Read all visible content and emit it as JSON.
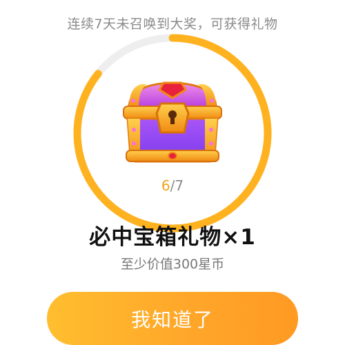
{
  "dialog": {
    "subtitle": "连续7天未召唤到大奖，可获得礼物",
    "progress": {
      "current": "6",
      "separator": "/",
      "total": "7",
      "fraction": 0.857
    },
    "prize_title": "必中宝箱礼物×1",
    "prize_desc": "至少价值300星币",
    "confirm_label": "我知道了"
  },
  "colors": {
    "accent": "#ffb21f",
    "ring_track": "#eeeeee",
    "progress_current": "#f0a419",
    "button_start": "#ffbe2f",
    "button_end": "#ff9a22"
  },
  "icons": {
    "chest": "treasure-chest-icon"
  }
}
